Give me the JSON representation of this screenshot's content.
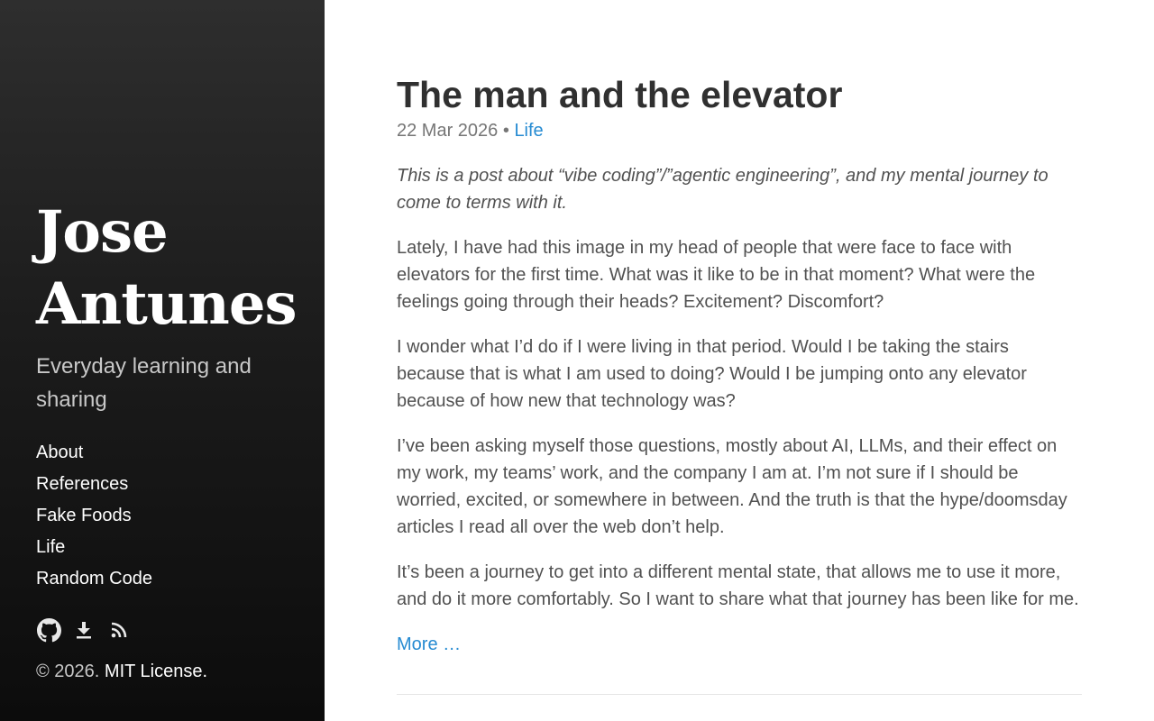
{
  "sidebar": {
    "title_line1": "Jose",
    "title_line2": "Antunes",
    "tagline": "Everyday learning and sharing",
    "nav": [
      {
        "label": "About"
      },
      {
        "label": "References"
      },
      {
        "label": "Fake Foods"
      },
      {
        "label": "Life"
      },
      {
        "label": "Random Code"
      }
    ],
    "social_icons": [
      "github-icon",
      "download-icon",
      "rss-icon"
    ],
    "copyright_text": "© 2026.",
    "license_label": "MIT License."
  },
  "post": {
    "title": "The man and the elevator",
    "date": "22 Mar 2026",
    "separator": "•",
    "category": "Life",
    "intro": "This is a post about “vibe coding”/”agentic engineering”, and my mental journey to come to terms with it.",
    "paragraphs": [
      "Lately, I have had this image in my head of people that were face to face with elevators for the first time. What was it like to be in that moment? What were the feelings going through their heads? Excitement? Discomfort?",
      "I wonder what I’d do if I were living in that period. Would I be taking the stairs because that is what I am used to doing? Would I be jumping onto any elevator because of how new that technology was?",
      "I’ve been asking myself those questions, mostly about AI, LLMs, and their effect on my work, my teams’ work, and the company I am at. I’m not sure if I should be worried, excited, or somewhere in between. And the truth is that the hype/doomsday articles I read all over the web don’t help.",
      "It’s been a journey to get into a different mental state, that allows me to use it more, and do it more comfortably. So I want to share what that journey has been like for me."
    ],
    "more_label": "More …"
  },
  "colors": {
    "link": "#268bd2",
    "sidebar_bg_top": "#2e2e2e",
    "sidebar_bg_bottom": "#0c0c0c",
    "body_text": "#515151",
    "title_text": "#303030"
  }
}
